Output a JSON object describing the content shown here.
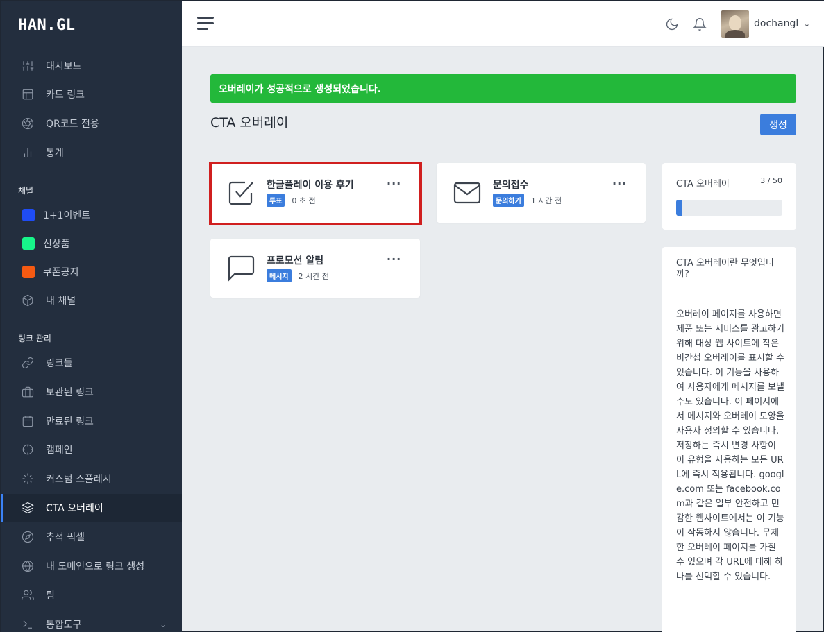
{
  "app": {
    "logo": "HAN.GL"
  },
  "sidebar": {
    "main": [
      {
        "label": "대시보드",
        "icon": "sliders-icon"
      },
      {
        "label": "카드 링크",
        "icon": "layout-icon"
      },
      {
        "label": "QR코드 전용",
        "icon": "aperture-icon"
      },
      {
        "label": "통계",
        "icon": "bar-chart-icon"
      }
    ],
    "channels_label": "채널",
    "channels": [
      {
        "label": "1+1이벤트",
        "color": "#1f4cf5"
      },
      {
        "label": "신상품",
        "color": "#17f58a"
      },
      {
        "label": "쿠폰공지",
        "color": "#f55a12"
      },
      {
        "label": "내 채널",
        "icon": "package-icon"
      }
    ],
    "links_label": "링크 관리",
    "links": [
      {
        "label": "링크들",
        "icon": "link-icon"
      },
      {
        "label": "보관된 링크",
        "icon": "briefcase-icon"
      },
      {
        "label": "만료된 링크",
        "icon": "calendar-icon"
      },
      {
        "label": "캠페인",
        "icon": "crosshair-icon"
      },
      {
        "label": "커스텀 스플레시",
        "icon": "loader-icon"
      },
      {
        "label": "CTA 오버레이",
        "icon": "layers-icon",
        "active": true
      },
      {
        "label": "추적 픽셀",
        "icon": "compass-icon"
      },
      {
        "label": "내 도메인으로 링크 생성",
        "icon": "globe-icon"
      },
      {
        "label": "팀",
        "icon": "users-icon"
      },
      {
        "label": "통합도구",
        "icon": "terminal-icon"
      }
    ]
  },
  "header": {
    "username": "dochangl"
  },
  "main": {
    "alert": "오버레이가 성공적으로 생성되었습니다.",
    "title": "CTA 오버레이",
    "create_label": "생성",
    "overlays": [
      {
        "title": "한글플레이 이용 후기",
        "badge": "투표",
        "time": "0 초 전",
        "icon": "check-square-icon"
      },
      {
        "title": "문의접수",
        "badge": "문의하기",
        "time": "1 시간 전",
        "icon": "mail-icon"
      },
      {
        "title": "프로모션 알림",
        "badge": "메시지",
        "time": "2 시간 전",
        "icon": "message-square-icon"
      }
    ],
    "more_label": "···"
  },
  "stats": {
    "title": "CTA 오버레이",
    "count": "3 / 50",
    "progress_fraction": 0.06
  },
  "info": {
    "title": "CTA 오버레이란 무엇입니까?",
    "body": "오버레이 페이지를 사용하면 제품 또는 서비스를 광고하기 위해 대상 웹 사이트에 작은 비간섭 오버레이를 표시할 수 있습니다. 이 기능을 사용하여 사용자에게 메시지를 보낼 수도 있습니다. 이 페이지에서 메시지와 오버레이 모양을 사용자 정의할 수 있습니다. 저장하는 즉시 변경 사항이 이 유형을 사용하는 모든 URL에 즉시 적용됩니다. google.com 또는 facebook.com과 같은 일부 안전하고 민감한 웹사이트에서는 이 기능이 작동하지 않습니다. 무제한 오버레이 페이지를 가질 수 있으며 각 URL에 대해 하나를 선택할 수 있습니다."
  }
}
